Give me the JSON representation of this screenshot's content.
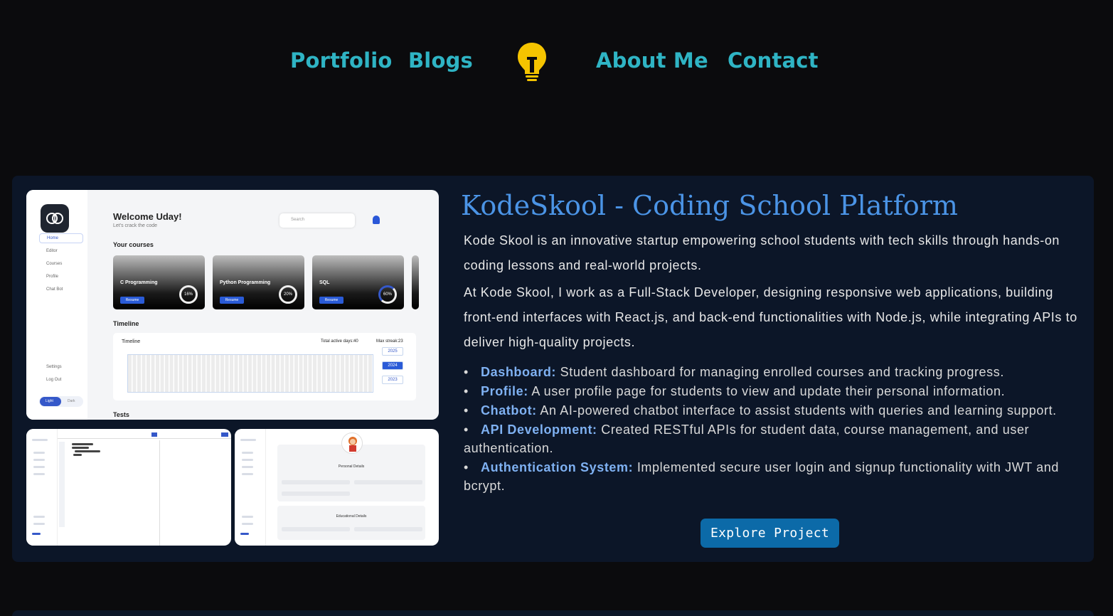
{
  "nav": {
    "items": [
      "Portfolio",
      "Blogs",
      "About Me",
      "Contact"
    ],
    "logo_icon": "lightbulb-icon",
    "accent": "#2fb4c4",
    "logo_color": "#f5c400"
  },
  "project": {
    "title": "KodeSkool - Coding School Platform",
    "description_1": "Kode Skool is an innovative startup empowering school students with tech skills through hands-on coding lessons and real-world projects.",
    "description_2": "At Kode Skool, I work as a Full-Stack Developer, designing responsive web applications, building front-end interfaces with React.js, and back-end functionalities with Node.js, while integrating APIs to deliver high-quality projects.",
    "features": [
      {
        "label": "Dashboard:",
        "text": " Student dashboard for managing enrolled courses and tracking progress."
      },
      {
        "label": "Profile:",
        "text": " A user profile page for students to view and update their personal information."
      },
      {
        "label": "Chatbot:",
        "text": " An AI-powered chatbot interface to assist students with queries and learning support."
      },
      {
        "label": "API Development:",
        "text": " Created RESTful APIs for student data, course management, and user authentication."
      },
      {
        "label": "Authentication System:",
        "text": " Implemented secure user login and signup functionality with JWT and bcrypt."
      }
    ],
    "button_label": "Explore Project",
    "title_color": "#4b94e6",
    "button_color": "#0c6aa8"
  },
  "screenshot": {
    "welcome": "Welcome Uday!",
    "subtitle": "Let's crack the code",
    "search_placeholder": "Search",
    "your_courses": "Your courses",
    "courses": [
      {
        "name": "C Programming",
        "progress": "16%"
      },
      {
        "name": "Python Programming",
        "progress": "20%"
      },
      {
        "name": "SQL",
        "progress": "60%"
      }
    ],
    "resume": "Resume",
    "timeline": "Timeline",
    "timeline_label": "Timeline",
    "active_days": "Total active days:40",
    "max_streak": "Max streak:23",
    "years": [
      "2025",
      "2024",
      "2023"
    ],
    "tests": "Tests",
    "sidebar": [
      "Home",
      "Editor",
      "Courses",
      "Profile",
      "Chat Bot",
      "Settings",
      "Log Out"
    ],
    "theme_light": "Light",
    "theme_dark": "Dark",
    "personal_details": "Personal Details",
    "educational_details": "Educational Details"
  }
}
